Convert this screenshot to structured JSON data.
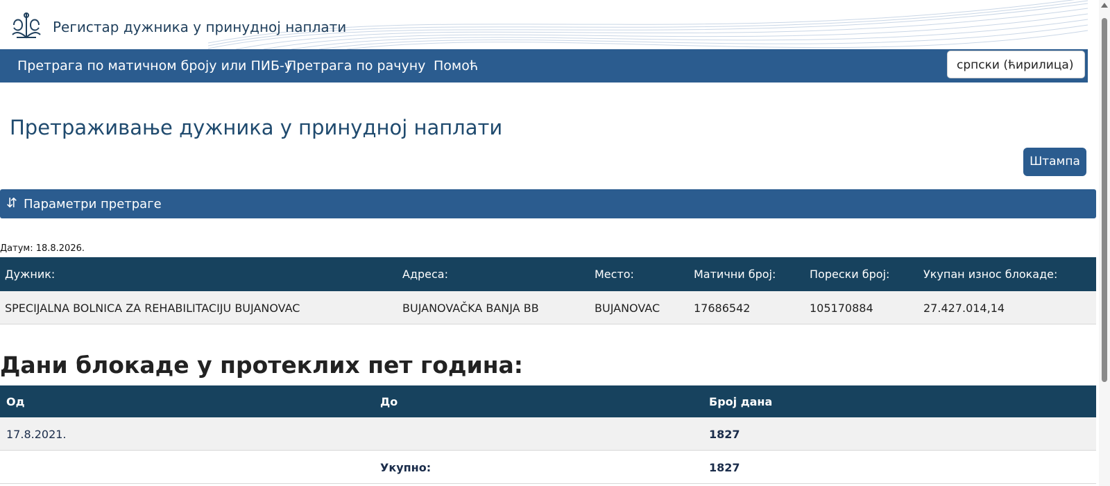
{
  "header": {
    "title": "Регистар дужника у принудној наплати",
    "logo_icon": "emblem-logo-icon"
  },
  "nav": {
    "items": [
      {
        "label": "Претрага по матичном броју или ПИБ-у"
      },
      {
        "label": "Претрага по рачуну"
      },
      {
        "label": "Помоћ"
      }
    ],
    "language": "српски (ћирилица)"
  },
  "page": {
    "title": "Претраживање дужника у принудној наплати",
    "print_label": "Штампа",
    "params_label": "Параметри претраге",
    "params_icon": "sort-arrows-icon",
    "date_line": "Датум: 18.8.2026."
  },
  "debtor_table": {
    "headers": [
      "Дужник:",
      "Адреса:",
      "Место:",
      "Матични број:",
      "Порески број:",
      "Укупан износ блокаде:"
    ],
    "row": {
      "name": "SPECIJALNA BOLNICA ZA REHABILITACIJU BUJANOVAC",
      "address": "BUJANOVAČKA BANJA BB",
      "place": "BUJANOVAC",
      "registration_number": "17686542",
      "tax_number": "105170884",
      "total_blocked": "27.427.014,14"
    }
  },
  "block_days": {
    "title": "Дани блокаде у протеклих пет година:",
    "headers": [
      "Од",
      "До",
      "Број дана"
    ],
    "rows": [
      {
        "from": "17.8.2021.",
        "to": "",
        "days": "1827"
      }
    ],
    "total_label": "Укупно:",
    "total_days": "1827"
  },
  "colors": {
    "nav_blue": "#2b5c8f",
    "table_head": "#17425e",
    "title_blue": "#1f4a6e"
  }
}
